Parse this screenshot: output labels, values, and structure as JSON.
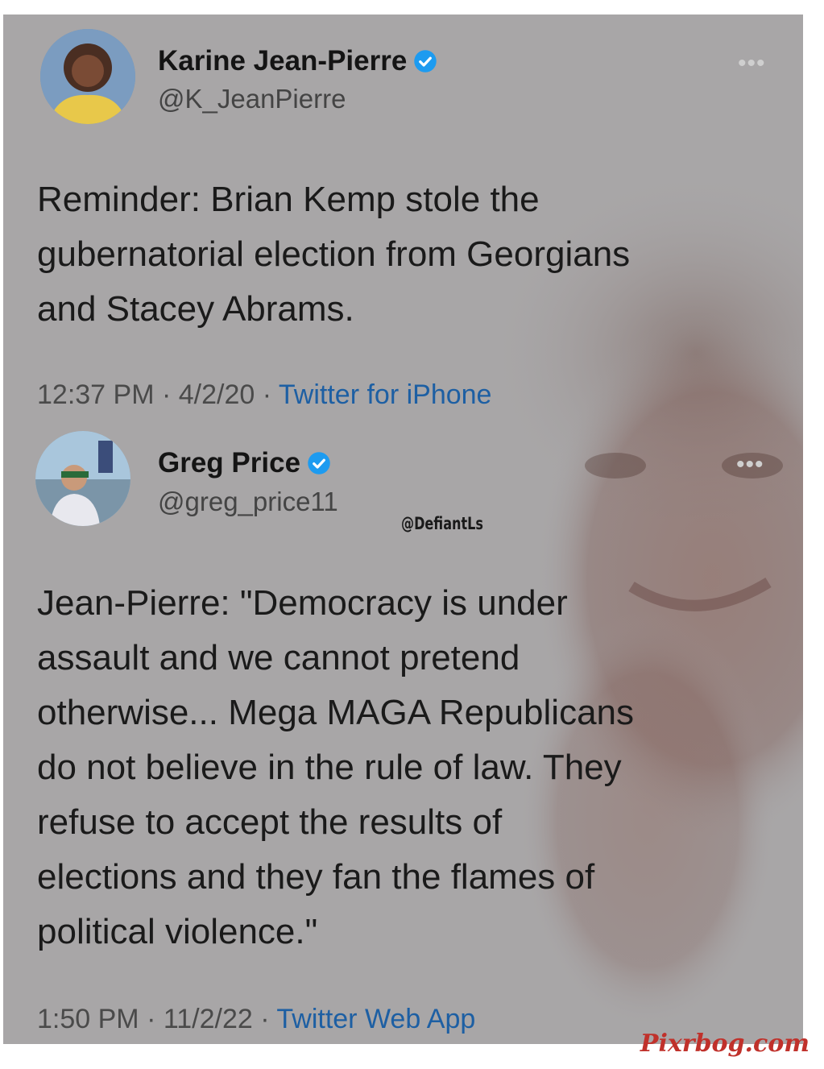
{
  "tweets": [
    {
      "name": "Karine Jean-Pierre",
      "handle": "@K_JeanPierre",
      "verified": true,
      "more_icon": "more-dots-icon",
      "text": "Reminder: Brian Kemp stole the\ngubernatorial election from  Georgians\nand Stacey Abrams.",
      "time": "12:37 PM",
      "date": "4/2/20",
      "source": "Twitter for iPhone"
    },
    {
      "name": "Greg Price",
      "handle": "@greg_price11",
      "verified": true,
      "more_icon": "more-dots-icon",
      "text": "Jean-Pierre: \"Democracy is under\nassault and we cannot pretend\notherwise... Mega MAGA Republicans\ndo not believe in the rule of law. They\nrefuse to accept the results of\nelections and they fan the flames of\npolitical violence.\"",
      "time": "1:50 PM",
      "date": "11/2/22",
      "source": "Twitter Web App"
    }
  ],
  "separator": " · ",
  "watermark_handle": "@DefiantLs",
  "site_watermark": "Pixrbog.com",
  "colors": {
    "card_bg": "#a8a6a7",
    "verified": "#1d9bf0",
    "link": "#1d5fa3",
    "watermark": "#c0312b"
  }
}
